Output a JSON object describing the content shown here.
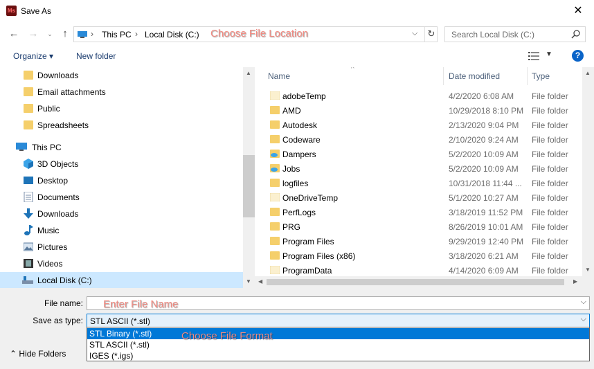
{
  "window": {
    "title": "Save As",
    "app_icon_text": "Ms"
  },
  "address": {
    "crumbs": [
      "This PC",
      "Local Disk (C:)"
    ],
    "annotation": "Choose File Location"
  },
  "search": {
    "placeholder": "Search Local Disk (C:)"
  },
  "toolbar": {
    "organize_label": "Organize ▾",
    "new_folder_label": "New folder",
    "help_label": "?"
  },
  "nav": {
    "items": [
      {
        "label": "Downloads",
        "icon": "folder-icon"
      },
      {
        "label": "Email attachments",
        "icon": "folder-icon"
      },
      {
        "label": "Public",
        "icon": "folder-icon"
      },
      {
        "label": "Spreadsheets",
        "icon": "folder-icon"
      },
      {
        "label": "This PC",
        "icon": "pc-icon"
      },
      {
        "label": "3D Objects",
        "icon": "cube-icon"
      },
      {
        "label": "Desktop",
        "icon": "desktop-icon"
      },
      {
        "label": "Documents",
        "icon": "document-icon"
      },
      {
        "label": "Downloads",
        "icon": "download-icon"
      },
      {
        "label": "Music",
        "icon": "music-icon"
      },
      {
        "label": "Pictures",
        "icon": "pictures-icon"
      },
      {
        "label": "Videos",
        "icon": "videos-icon"
      },
      {
        "label": "Local Disk (C:)",
        "icon": "drive-icon"
      }
    ]
  },
  "files": {
    "columns": {
      "name": "Name",
      "date": "Date modified",
      "type": "Type"
    },
    "rows": [
      {
        "name": "adobeTemp",
        "date": "4/2/2020 6:08 AM",
        "type": "File folder"
      },
      {
        "name": "AMD",
        "date": "10/29/2018 8:10 PM",
        "type": "File folder"
      },
      {
        "name": "Autodesk",
        "date": "2/13/2020 9:04 PM",
        "type": "File folder"
      },
      {
        "name": "Codeware",
        "date": "2/10/2020 9:24 AM",
        "type": "File folder"
      },
      {
        "name": "Dampers",
        "date": "5/2/2020 10:09 AM",
        "type": "File folder"
      },
      {
        "name": "Jobs",
        "date": "5/2/2020 10:09 AM",
        "type": "File folder"
      },
      {
        "name": "logfiles",
        "date": "10/31/2018 11:44 ...",
        "type": "File folder"
      },
      {
        "name": "OneDriveTemp",
        "date": "5/1/2020 10:27 AM",
        "type": "File folder"
      },
      {
        "name": "PerfLogs",
        "date": "3/18/2019 11:52 PM",
        "type": "File folder"
      },
      {
        "name": "PRG",
        "date": "8/26/2019 10:01 AM",
        "type": "File folder"
      },
      {
        "name": "Program Files",
        "date": "9/29/2019 12:40 PM",
        "type": "File folder"
      },
      {
        "name": "Program Files (x86)",
        "date": "3/18/2020 6:21 AM",
        "type": "File folder"
      },
      {
        "name": "ProgramData",
        "date": "4/14/2020 6:09 AM",
        "type": "File folder"
      }
    ]
  },
  "form": {
    "filename_label": "File name:",
    "filename_value": "",
    "filename_annotation": "Enter File Name",
    "type_label": "Save as type:",
    "type_value": "STL ASCII (*.stl)",
    "type_options": [
      "STL Binary (*.stl)",
      "STL ASCII (*.stl)",
      "IGES (*.igs)"
    ],
    "type_annotation": "Choose File Format",
    "hide_folders_label": "Hide Folders"
  },
  "colors": {
    "accent": "#0078d7",
    "folder": "#f5cf6b",
    "selected_nav": "#cce8ff",
    "annotation": "#f28b82"
  }
}
